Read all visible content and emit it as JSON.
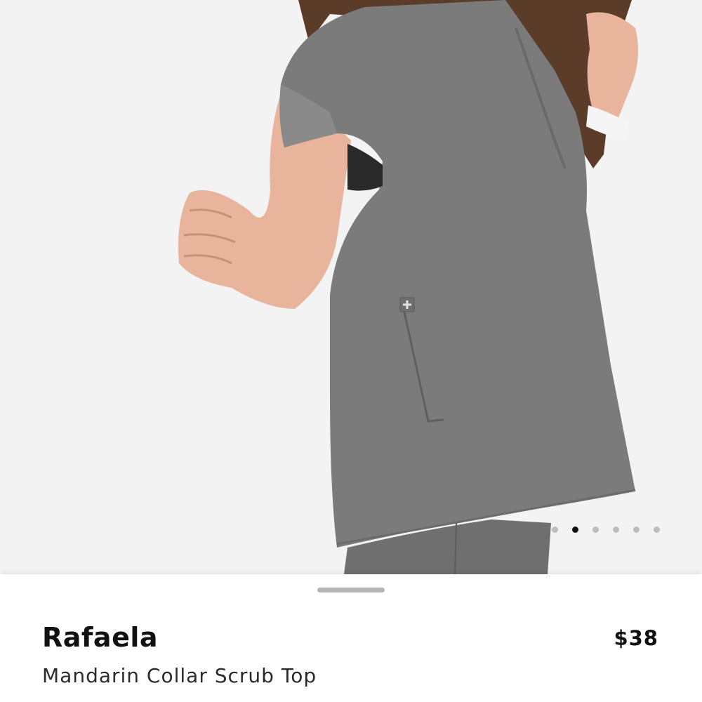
{
  "product": {
    "name": "Rafaela",
    "subtitle": "Mandarin Collar Scrub Top",
    "price": "$38"
  },
  "gallery": {
    "image_count": 6,
    "active_index": 1,
    "background_color": "#f3f3f3",
    "garment_color": "#7a7a7a"
  }
}
